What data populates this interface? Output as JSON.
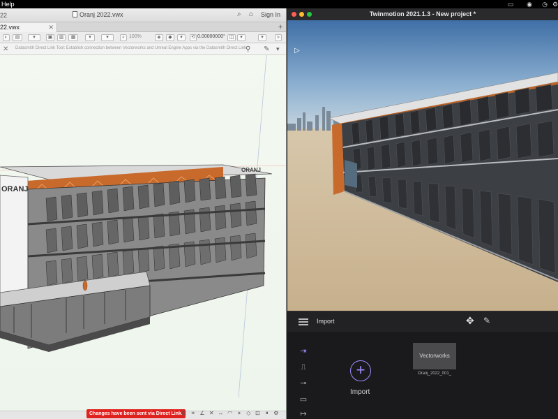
{
  "menubar": {
    "help_label": "Help",
    "status_icons": [
      "screen-icon",
      "record-icon",
      "timer-icon",
      "control-icon"
    ]
  },
  "vectorworks": {
    "title_year": "22",
    "file_title": "Oranj 2022.vwx",
    "sign_in": "Sign In",
    "tab_label": "22.vwx",
    "toolbar": {
      "zoom": "100%",
      "coordinate": "0.00000000°"
    },
    "tool_hint": "Datasmith Direct Link Tool: Establish connection between Vectorworks and Unreal Engine Apps via the Datasmith Direct Link.",
    "building_sign": "ORANJ",
    "status_message": "Changes have been sent via Direct Link."
  },
  "twinmotion": {
    "window_title": "Twinmotion 2021.1.3 - New project *",
    "toolbar_label": "Import",
    "import_label": "Import",
    "asset_card_label": "Vectorworks",
    "asset_name": "Oranj_2022_001_",
    "side_icons": [
      "import-icon",
      "landscape-icon",
      "path-icon",
      "media-icon",
      "export-icon"
    ]
  },
  "colors": {
    "accent_purple": "#a08cff",
    "direct_link_red": "#e0221f",
    "building_orange": "#c96a2d"
  }
}
